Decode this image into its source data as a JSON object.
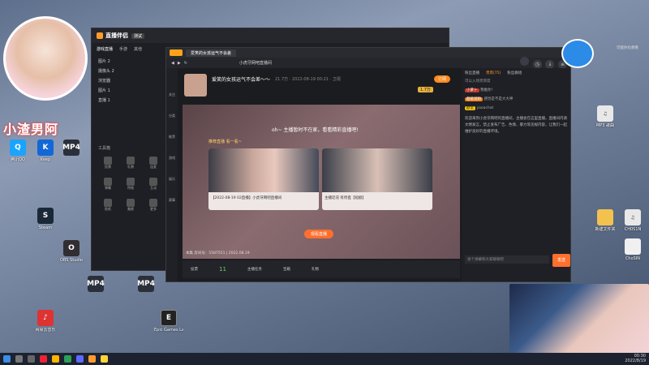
{
  "desktop": {
    "icons": [
      {
        "label": "腾讯QQ",
        "color": "#1aa3ff",
        "g": "Q"
      },
      {
        "label": "Keep",
        "color": "#111",
        "g": "K"
      },
      {
        "label": "Steam",
        "color": "#1b2838",
        "g": "S"
      },
      {
        "label": "OBS Studio",
        "color": "#302e31",
        "g": "O"
      },
      {
        "label": "网易云音乐",
        "color": "#d33",
        "g": "♪"
      },
      {
        "label": "Epic Games Launcher",
        "color": "#222",
        "g": "E"
      }
    ],
    "mp4_label": "MP4",
    "right_icons": [
      "新建文件夹",
      "MP3 歌曲",
      "CH0S1N",
      "ChoSIN"
    ]
  },
  "streamer_overlay": {
    "name_text": "小渣男阿"
  },
  "app": {
    "title": "直播伴侣",
    "badge": "测试",
    "sidebar_tabs": [
      "游戏直播",
      "手游",
      "其他"
    ],
    "scene_items": [
      "图片 2",
      "摄像头 2",
      "浏览器",
      "图片 1",
      "直播 1"
    ],
    "tools_title": "工具箱",
    "tools": [
      "投票",
      "礼物",
      "连麦",
      "弹幕",
      "特效",
      "互动",
      "贴纸",
      "美颜",
      "更多"
    ]
  },
  "browser": {
    "tab_title": "爱笑的女孩运气不会差",
    "address": "小虎牙网吧直播间",
    "room_title": "爱笑的女孩运气不会差～～",
    "room_meta": "21.7万 · 2022-08-19 00:21 · 卫视",
    "follow_label": "订阅",
    "rank_badge": "1.7万",
    "left_nav": [
      "关注",
      "分类",
      "推荐",
      "游戏",
      "娱乐",
      "赛事"
    ],
    "offline_msg": "oh~ 主播暂时不在家，看看精彩直播吧!",
    "section_label": "推荐直播 看一看~",
    "videos": [
      {
        "title": "【2022-08-19 02直播】小虎牙网吧直播间",
        "count": "11"
      },
      {
        "title": "主播近况 有停直【短剧】",
        "count": "102.7万"
      }
    ],
    "replay_btn": "观看直播",
    "footer_info": "本集 房间号：5587551 | 2022.08.19",
    "player_bar": [
      "投票",
      "主播任务",
      "宝箱",
      "礼物"
    ],
    "level_num": "11",
    "right_tabs": [
      "粉丝直播",
      "贵宾(75)",
      "粉丝群组"
    ],
    "chat_notice": "可以入场贵宾席",
    "chat_msgs": [
      {
        "name": "小萝卜",
        "text": "我推你！"
      },
      {
        "name": "超级宠粉",
        "text": "感觉是不是大大神"
      },
      {
        "name": "欧皇",
        "text": "yaoachat"
      }
    ],
    "sys_msg": "欢迎来到小虎牙网吧的直播间，主播会在这里直播，直播间内请文明发言，禁止发布广告、色情、暴力等违规内容，让我们一起维护良好的直播环境。",
    "chat_input_placeholder": "发个弹幕和大家聊聊吧",
    "send_btn": "发送",
    "top_hint": "可能你也想看"
  },
  "taskbar": {
    "time": "00:30",
    "date": "2022/8/19"
  }
}
